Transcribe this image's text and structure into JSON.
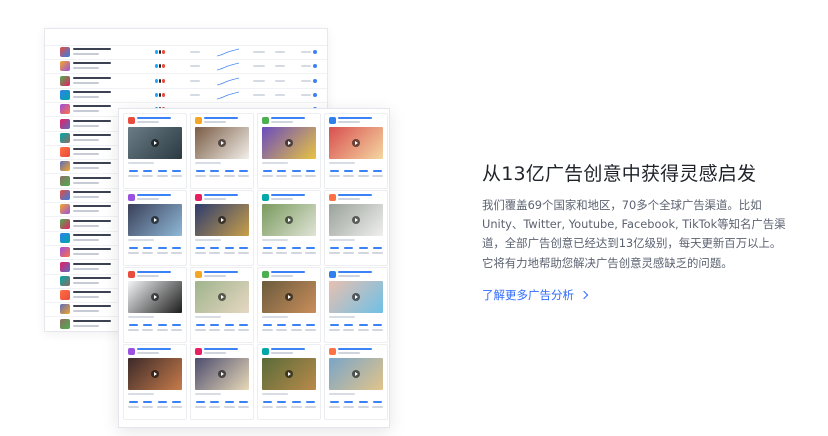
{
  "feature": {
    "title": "从13亿广告创意中获得灵感启发",
    "description": "我们覆盖69个国家和地区，70多个全球广告渠道。比如Unity、Twitter, Youtube, Facebook, TikTok等知名广告渠道，全部广告创意已经达到13亿级别，每天更新百万以上。它将有力地帮助您解决广告创意灵感缺乏的问题。",
    "link_label": "了解更多广告分析"
  },
  "colors": {
    "accent": "#2f6bff",
    "title": "#1f2329",
    "body": "#5b6270"
  },
  "illustration": {
    "ranking_rows": 20,
    "creative_cards": 16
  }
}
